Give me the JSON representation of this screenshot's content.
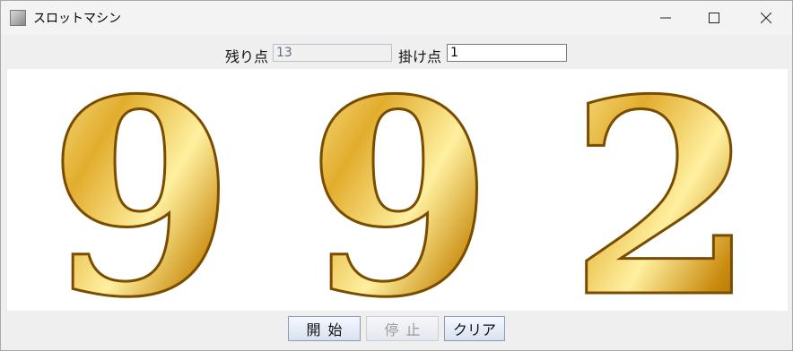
{
  "window": {
    "title": "スロットマシン",
    "icon": "app-icon"
  },
  "toolbar": {
    "remaining_label": "残り点",
    "remaining_value": "13",
    "bet_label": "掛け点",
    "bet_value": "1"
  },
  "reels": [
    {
      "value": "9"
    },
    {
      "value": "9"
    },
    {
      "value": "2"
    }
  ],
  "buttons": {
    "start": "開始",
    "stop": "停止",
    "clear": "クリア"
  },
  "colors": {
    "gold_light": "#f7d86a",
    "gold_mid": "#d39a18",
    "gold_dark": "#8b5a00",
    "window_bg": "#efefef"
  }
}
